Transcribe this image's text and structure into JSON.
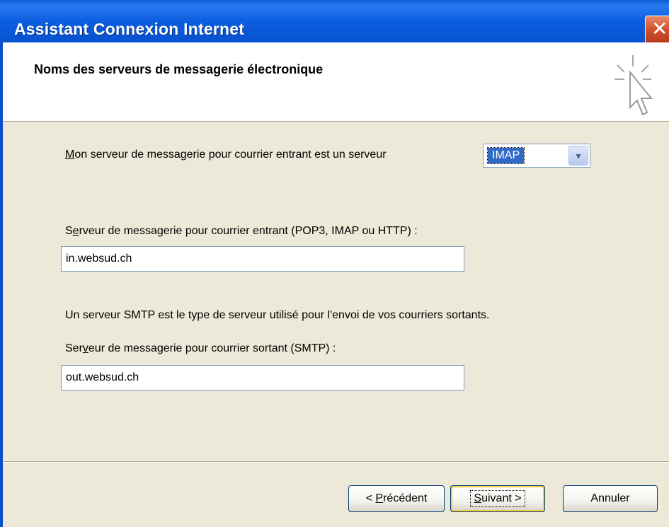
{
  "window": {
    "title": "Assistant Connexion Internet",
    "close_glyph": "✕"
  },
  "header": {
    "heading": "Noms des serveurs de messagerie électronique",
    "icon": "wizard-cursor-icon"
  },
  "incoming_type": {
    "label_accel": "M",
    "label_rest": "on serveur de messagerie pour courrier entrant est un serveur",
    "selected": "IMAP"
  },
  "incoming_server": {
    "label_first": "S",
    "label_accel": "e",
    "label_rest": "rveur de messagerie pour courrier entrant (POP3, IMAP ou HTTP) :",
    "value": "in.websud.ch"
  },
  "smtp_info": "Un serveur SMTP est le type de serveur utilisé pour l'envoi de vos courriers sortants.",
  "outgoing_server": {
    "label_first": "Ser",
    "label_accel": "v",
    "label_rest": "eur de messagerie pour courrier sortant (SMTP) :",
    "value": "out.websud.ch"
  },
  "buttons": {
    "back_prefix": "< ",
    "back_accel": "P",
    "back_rest": "récédent",
    "next_accel": "S",
    "next_rest": "uivant >",
    "cancel": "Annuler"
  },
  "colors": {
    "titlebar": "#0a5fd8",
    "dialog_bg": "#ece9d8",
    "selection": "#316ac5"
  }
}
